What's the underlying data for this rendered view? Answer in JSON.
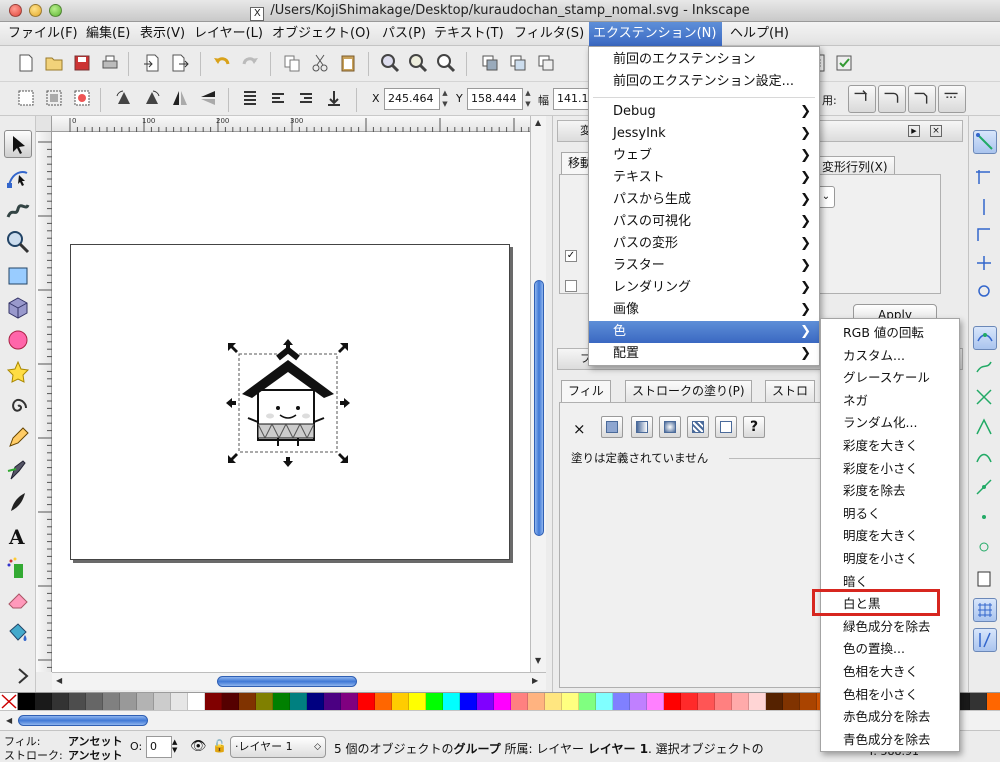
{
  "window": {
    "title": "/Users/KojiShimakage/Desktop/kuraudochan_stamp_nomal.svg - Inkscape"
  },
  "menubar": [
    {
      "label": "ファイル(F)"
    },
    {
      "label": "編集(E)"
    },
    {
      "label": "表示(V)"
    },
    {
      "label": "レイヤー(L)"
    },
    {
      "label": "オブジェクト(O)"
    },
    {
      "label": "パス(P)"
    },
    {
      "label": "テキスト(T)"
    },
    {
      "label": "フィルタ(S)"
    },
    {
      "label": "エクステンション(N)"
    },
    {
      "label": "ヘルプ(H)"
    }
  ],
  "coords": {
    "x_label": "X",
    "x_value": "245.464",
    "y_label": "Y",
    "y_value": "158.444",
    "w_label": "幅",
    "w_value": "141.11",
    "extra_label": "用:"
  },
  "ruler": {
    "marks": [
      "0",
      "100",
      "200",
      "300"
    ]
  },
  "extensions_menu": {
    "recent": "前回のエクステンション",
    "recent_settings": "前回のエクステンション設定...",
    "items": [
      {
        "label": "Debug"
      },
      {
        "label": "JessyInk"
      },
      {
        "label": "ウェブ"
      },
      {
        "label": "テキスト"
      },
      {
        "label": "パスから生成"
      },
      {
        "label": "パスの可視化"
      },
      {
        "label": "パスの変形"
      },
      {
        "label": "ラスター"
      },
      {
        "label": "レンダリング"
      },
      {
        "label": "画像"
      },
      {
        "label": "色"
      },
      {
        "label": "配置"
      }
    ]
  },
  "color_submenu": {
    "items": [
      {
        "label": "RGB 値の回転"
      },
      {
        "label": "カスタム..."
      },
      {
        "label": "グレースケール"
      },
      {
        "label": "ネガ"
      },
      {
        "label": "ランダム化..."
      },
      {
        "label": "彩度を大きく"
      },
      {
        "label": "彩度を小さく"
      },
      {
        "label": "彩度を除去"
      },
      {
        "label": "明るく"
      },
      {
        "label": "明度を大きく"
      },
      {
        "label": "明度を小さく"
      },
      {
        "label": "暗く"
      },
      {
        "label": "白と黒"
      },
      {
        "label": "緑色成分を除去"
      },
      {
        "label": "色の置換..."
      },
      {
        "label": "色相を大きく"
      },
      {
        "label": "色相を小さく"
      },
      {
        "label": "赤色成分を除去"
      },
      {
        "label": "青色成分を除去"
      }
    ]
  },
  "transform_dialog": {
    "header": "変",
    "tab_move": "移動",
    "tab_matrix": "変形行列(X)",
    "apply_label": "Apply"
  },
  "fill_dialog": {
    "header": "フ",
    "tab_fill": "フィル",
    "tab_stroke_paint": "ストロークの塗り(P)",
    "tab_stroke_style": "ストロ",
    "message": "塗りは定義されていません",
    "unset_label": "?",
    "none_label": "×"
  },
  "statusbar": {
    "fill_label": "フィル:",
    "fill_value": "アンセット",
    "stroke_label": "ストローク:",
    "stroke_value": "アンセット",
    "opacity_label": "O:",
    "opacity_value": "0",
    "layer_value": "·レイヤー 1",
    "message_prefix": "5 個のオブジェクトの",
    "message_group": "グループ",
    "message_mid": " 所属: レイヤー",
    "message_layer": "レイヤー 1",
    "message_suffix": ". 選択オブジェクトの",
    "coord_y": "Y: 588.91"
  },
  "palette": [
    "#000000",
    "#1a1a1a",
    "#333333",
    "#4d4d4d",
    "#666666",
    "#808080",
    "#999999",
    "#b3b3b3",
    "#cccccc",
    "#e6e6e6",
    "#ffffff",
    "#800000",
    "#550000",
    "#803300",
    "#808000",
    "#008000",
    "#008080",
    "#000080",
    "#4b0082",
    "#800080",
    "#ff0000",
    "#ff6600",
    "#ffcc00",
    "#ffff00",
    "#00ff00",
    "#00ffff",
    "#0000ff",
    "#8000ff",
    "#ff00ff",
    "#ff8080",
    "#ffb380",
    "#ffe680",
    "#ffff80",
    "#80ff80",
    "#80ffff",
    "#8080ff",
    "#c080ff",
    "#ff80ff",
    "#ff0000",
    "#ff2a2a",
    "#ff5555",
    "#ff8080",
    "#ffaaaa",
    "#ffd5d5",
    "#552200",
    "#803300",
    "#aa4400",
    "#d45500",
    "#ff6600",
    "#ff7f2a",
    "#ff9955",
    "#ffb380",
    "#ffccaa",
    "#ffe6d5",
    "#000000",
    "#1a1a1a",
    "#333333",
    "#ff6600"
  ],
  "colors": {
    "highlight": "#3a68c2",
    "callout": "#d7261f",
    "scroll": "#3f78d6"
  }
}
